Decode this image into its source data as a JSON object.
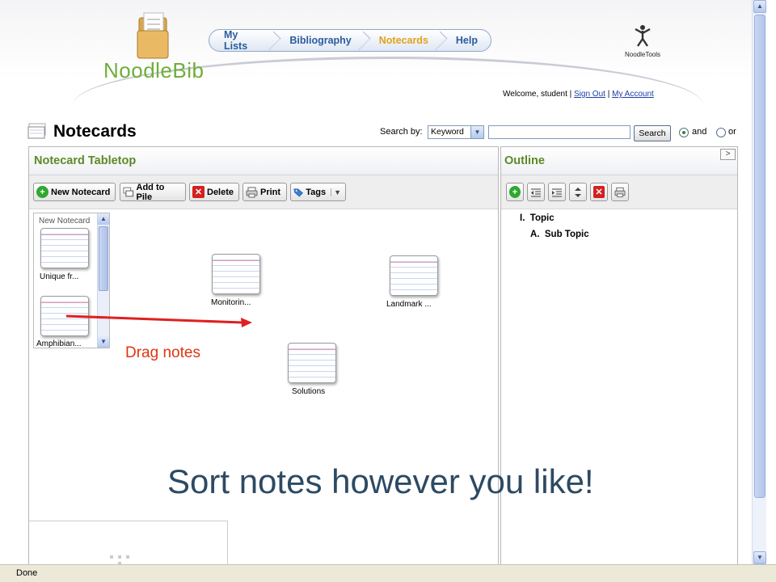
{
  "app": {
    "logo": "NoodleBib",
    "brand_right": "NoodleTools"
  },
  "nav": {
    "items": [
      "My Lists",
      "Bibliography",
      "Notecards",
      "Help"
    ],
    "active": "Notecards"
  },
  "welcome": {
    "text": "Welcome, student |",
    "sign_out": "Sign Out",
    "sep": "|",
    "account": "My Account"
  },
  "page": {
    "title": "Notecards"
  },
  "search": {
    "label": "Search by:",
    "selected": "Keyword",
    "value": "",
    "button": "Search",
    "and_label": "and",
    "or_label": "or",
    "mode": "and"
  },
  "tabletop": {
    "title": "Notecard Tabletop",
    "toolbar": {
      "new": "New Notecard",
      "add_pile": "Add to Pile",
      "delete": "Delete",
      "print": "Print",
      "tags": "Tags"
    },
    "new_list_title": "New Notecard",
    "new_cards": [
      "Unique fr...",
      "Amphibian..."
    ],
    "cards": [
      "Monitorin...",
      "Landmark ...",
      "Solutions"
    ]
  },
  "outline": {
    "title": "Outline",
    "collapse": ">",
    "tree": [
      {
        "num": "I.",
        "label": "Topic"
      },
      {
        "num": "A.",
        "label": "Sub Topic"
      }
    ]
  },
  "annotations": {
    "drag": "Drag notes",
    "caption": "Sort notes however you like!"
  },
  "status": "Done",
  "colors": {
    "accent_green": "#5b8a26",
    "nav_blue": "#2b5c9e",
    "nav_active": "#e0a31a",
    "arrow_red": "#e02020"
  }
}
